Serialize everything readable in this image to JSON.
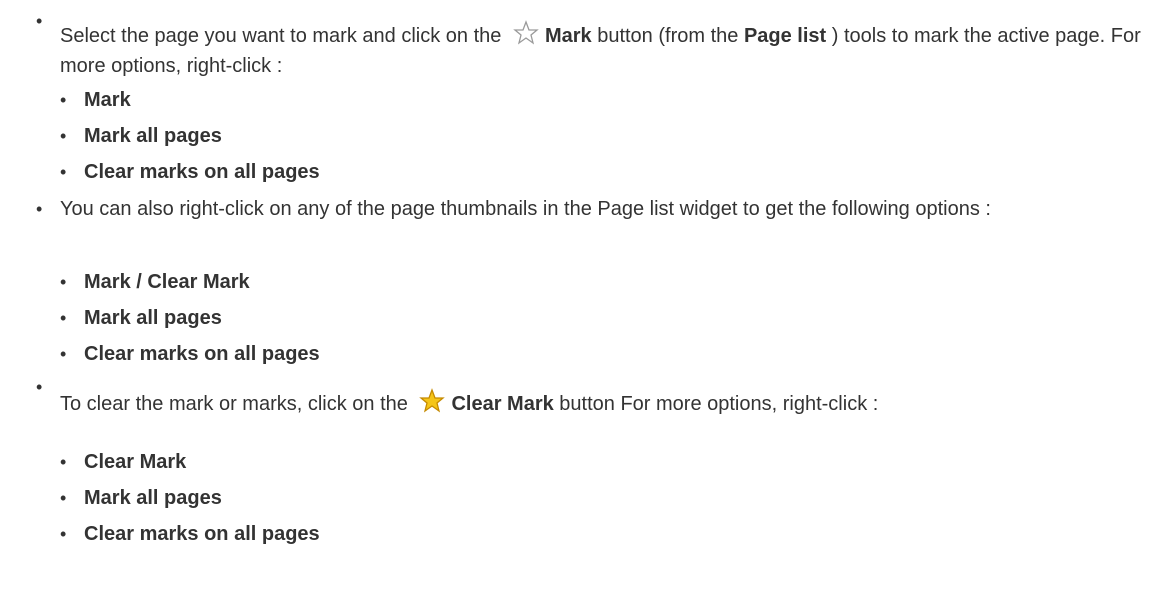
{
  "items": [
    {
      "text_a": "Select the page you want to mark and click on the ",
      "bold_a": "Mark",
      "text_b": " button (from the ",
      "bold_b": "Page list",
      "text_c": " ) tools to mark the active page. For more options, right-click :",
      "icon": "star-outline-icon",
      "sub": [
        "Mark",
        "Mark all pages",
        "Clear marks on all pages"
      ]
    },
    {
      "text_a": "You can also right-click on any of the page thumbnails in the Page list widget to get the following options :",
      "sub": [
        "Mark / Clear Mark",
        "Mark all pages",
        "Clear marks on all pages"
      ]
    },
    {
      "text_a": "To clear the mark or marks, click on the ",
      "bold_a": "Clear Mark",
      "text_b": " button For more options, right-click :",
      "icon": "star-filled-icon",
      "sub": [
        "Clear Mark",
        "Mark all pages",
        "Clear marks on all pages"
      ]
    }
  ],
  "colors": {
    "text": "#333333",
    "star_fill": "#f5c518",
    "star_outline": "#9a9a9a"
  }
}
